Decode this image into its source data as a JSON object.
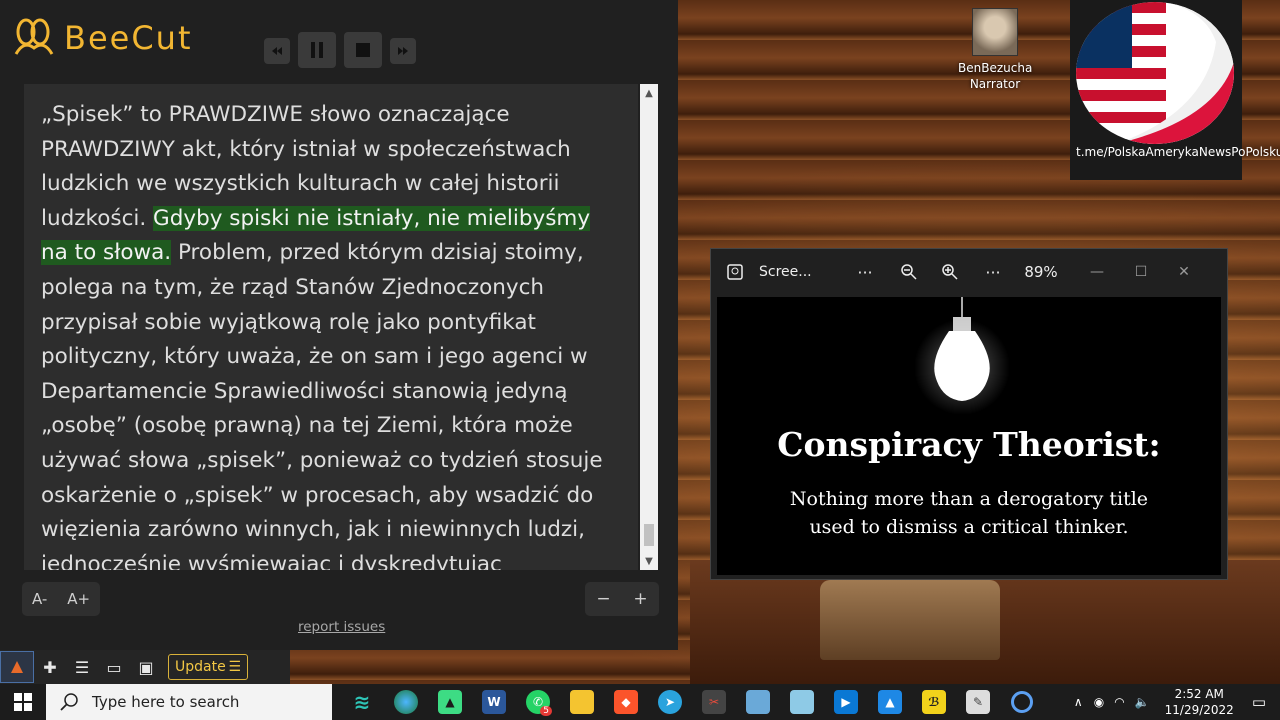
{
  "reader": {
    "brand": "BeeCut",
    "text_before": "„Spisek” to PRAWDZIWE słowo oznaczające PRAWDZIWY akt, który istniał w społeczeństwach ludzkich we wszystkich kulturach w całej historii ludzkości. ",
    "text_highlight": "Gdyby spiski nie istniały, nie mielibyśmy na to słowa.",
    "text_after": " Problem, przed którym dzisiaj stoimy, polega na tym, że rząd Stanów Zjednoczonych przypisał sobie wyjątkową rolę jako pontyfikat polityczny, który uważa, że on sam i jego agenci w Departamencie Sprawiedliwości stanowią jedyną „osobę” (osobę prawną) na tej Ziemi, która może używać słowa „spisek”, ponieważ co tydzień stosuje oskarżenie o „spisek” w procesach, aby wsadzić do więzienia zarówno winnych, jak i niewinnych ludzi, jednocześnie wyśmiewając i dyskredytując",
    "font_decrease": "A-",
    "font_increase": "A+",
    "zoom_out": "−",
    "zoom_in": "+",
    "report": "report issues"
  },
  "extbar": {
    "update_label": "Update"
  },
  "narrator": {
    "name": "BenBezucha",
    "role": "Narrator"
  },
  "flag_caption": "t.me/PolskaAmerykaNewsPoPolsku",
  "viewer": {
    "title": "Scree...",
    "zoom": "89%",
    "image_title": "Conspiracy Theorist:",
    "image_line1": "Nothing more than a derogatory title",
    "image_line2": "used to dismiss a critical thinker."
  },
  "taskbar": {
    "search_placeholder": "Type here to search",
    "whatsapp_badge": "5",
    "time": "2:52 AM",
    "date": "11/29/2022"
  },
  "colors": {
    "brand": "#f2b632",
    "highlight": "#1f5a1f"
  }
}
